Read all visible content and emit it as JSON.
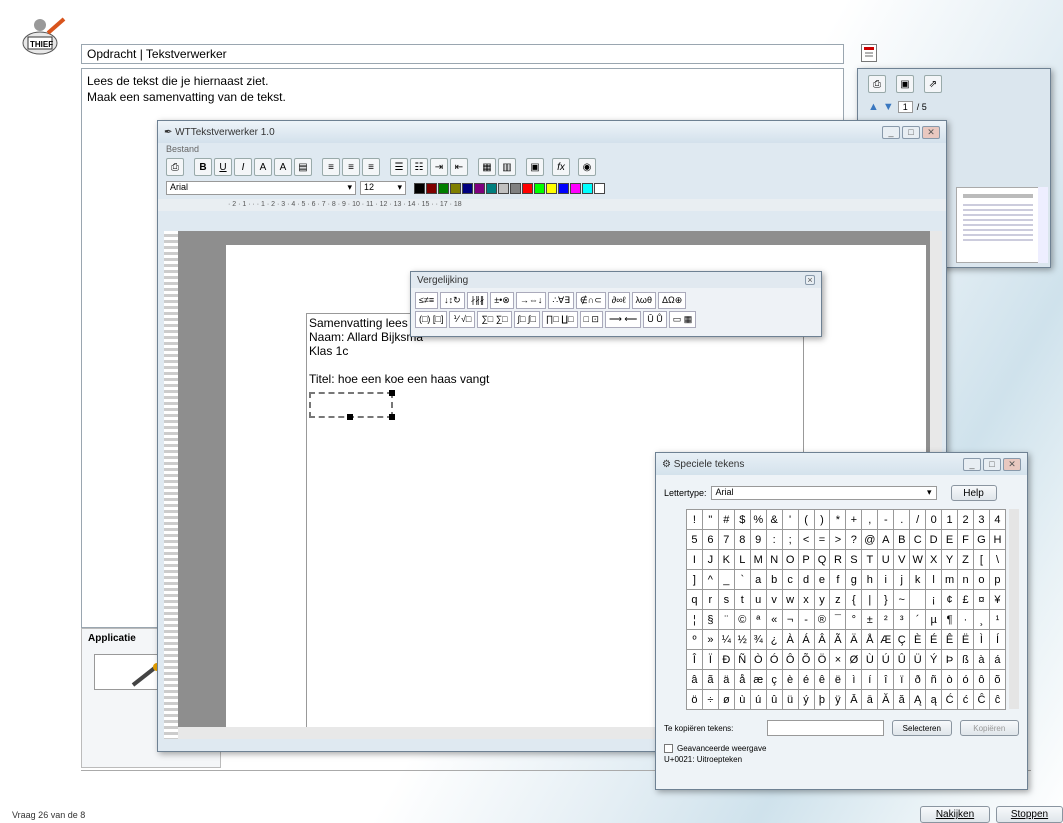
{
  "assignment": {
    "title": "Opdracht | Tekstverwerker",
    "lines": [
      "Lees de tekst die je hiernaast ziet.",
      "Maak een samenvatting van de tekst."
    ]
  },
  "application_panel": {
    "label": "Applicatie"
  },
  "status": {
    "question": "Vraag 26 van de 8"
  },
  "footer_buttons": {
    "check": "Nakijken",
    "stop": "Stoppen"
  },
  "pdf_viewer": {
    "page_current": "1",
    "page_total": "/ 5"
  },
  "editor": {
    "title": "WTTekstverwerker 1.0",
    "menu": "Bestand",
    "font": "Arial",
    "size": "12",
    "ruler": "· 2 · 1 · · · 1 · 2 · 3 · 4 · 5 · 6 · 7 · 8 · 9 · 10 · 11 · 12 · 13 · 14 · 15 · · 17 · 18",
    "doc_lines": [
      "Samenvatting lees",
      "Naam: Allard Bijksma",
      "Klas 1c",
      "",
      "Titel: hoe een koe een haas vangt"
    ],
    "colors": [
      "#000000",
      "#7f0000",
      "#007f00",
      "#7f7f00",
      "#00007f",
      "#7f007f",
      "#007f7f",
      "#c0c0c0",
      "#808080",
      "#ff0000",
      "#00ff00",
      "#ffff00",
      "#0000ff",
      "#ff00ff",
      "#00ffff",
      "#ffffff"
    ]
  },
  "equation": {
    "title": "Vergelijking",
    "row1": [
      "≤≠≡",
      "↓↕↻",
      "∤∦∦",
      "±•⊗",
      "→⇔↓",
      "∴∀∃",
      "∉∩⊂",
      "∂∞ℓ",
      "λωθ",
      "ΔΩ⊕"
    ],
    "row2": [
      "(□) [□]",
      "⅟ √□",
      "∑□ ∑□",
      "∫□ ∫□",
      "∏□ ∐□",
      "□ ⊡",
      "⟶ ⟵",
      "Ū Ů",
      "▭ ▦"
    ]
  },
  "special_chars": {
    "title": "Speciele tekens",
    "font_label": "Lettertype:",
    "font_value": "Arial",
    "help": "Help",
    "copy_label": "Te kopiëren tekens:",
    "select": "Selecteren",
    "copy": "Kopiëren",
    "advanced": "Geavanceerde weergave",
    "status": "U+0021: Uitroepteken",
    "rows": [
      [
        "!",
        "\"",
        "#",
        "$",
        "%",
        "&",
        "'",
        "(",
        ")",
        "*",
        "+",
        ",",
        "-",
        ".",
        "/",
        "0",
        "1",
        "2",
        "3",
        "4"
      ],
      [
        "5",
        "6",
        "7",
        "8",
        "9",
        ":",
        ";",
        "<",
        "=",
        ">",
        "?",
        "@",
        "A",
        "B",
        "C",
        "D",
        "E",
        "F",
        "G",
        "H"
      ],
      [
        "I",
        "J",
        "K",
        "L",
        "M",
        "N",
        "O",
        "P",
        "Q",
        "R",
        "S",
        "T",
        "U",
        "V",
        "W",
        "X",
        "Y",
        "Z",
        "[",
        "\\"
      ],
      [
        "]",
        "^",
        "_",
        "`",
        "a",
        "b",
        "c",
        "d",
        "e",
        "f",
        "g",
        "h",
        "i",
        "j",
        "k",
        "l",
        "m",
        "n",
        "o",
        "p"
      ],
      [
        "q",
        "r",
        "s",
        "t",
        "u",
        "v",
        "w",
        "x",
        "y",
        "z",
        "{",
        "|",
        "}",
        "~",
        " ",
        "¡",
        "¢",
        "£",
        "¤",
        "¥"
      ],
      [
        "¦",
        "§",
        "¨",
        "©",
        "ª",
        "«",
        "¬",
        "-",
        "®",
        "¯",
        "°",
        "±",
        "²",
        "³",
        "´",
        "µ",
        "¶",
        "·",
        "¸",
        "¹"
      ],
      [
        "º",
        "»",
        "¼",
        "½",
        "¾",
        "¿",
        "À",
        "Á",
        "Â",
        "Ã",
        "Ä",
        "Å",
        "Æ",
        "Ç",
        "È",
        "É",
        "Ê",
        "Ë",
        "Ì",
        "Í"
      ],
      [
        "Î",
        "Ï",
        "Ð",
        "Ñ",
        "Ò",
        "Ó",
        "Ô",
        "Õ",
        "Ö",
        "×",
        "Ø",
        "Ù",
        "Ú",
        "Û",
        "Ü",
        "Ý",
        "Þ",
        "ß",
        "à",
        "á"
      ],
      [
        "â",
        "ã",
        "ä",
        "å",
        "æ",
        "ç",
        "è",
        "é",
        "ê",
        "ë",
        "ì",
        "í",
        "î",
        "ï",
        "ð",
        "ñ",
        "ò",
        "ó",
        "ô",
        "õ"
      ],
      [
        "ö",
        "÷",
        "ø",
        "ù",
        "ú",
        "û",
        "ü",
        "ý",
        "þ",
        "ÿ",
        "Ā",
        "ā",
        "Ă",
        "ă",
        "Ą",
        "ą",
        "Ć",
        "ć",
        "Ĉ",
        "ĉ"
      ]
    ]
  }
}
